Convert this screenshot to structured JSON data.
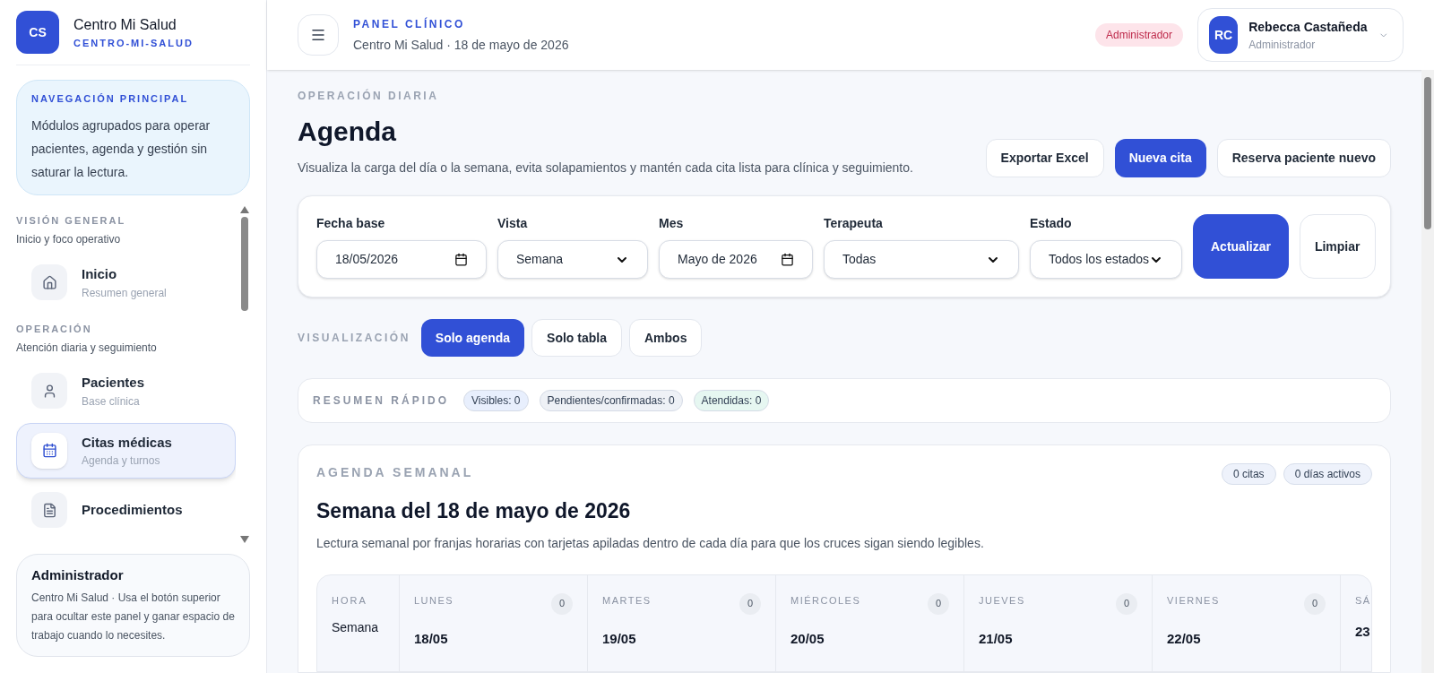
{
  "brand": {
    "initials": "CS",
    "name": "Centro Mi Salud",
    "slug": "CENTRO-MI-SALUD"
  },
  "sidebar": {
    "intro": {
      "title": "NAVEGACIÓN PRINCIPAL",
      "text": "Módulos agrupados para operar pacientes, agenda y gestión sin saturar la lectura."
    },
    "sections": [
      {
        "title": "VISIÓN GENERAL",
        "subtitle": "Inicio y foco operativo",
        "items": [
          {
            "kind": "home",
            "label": "Inicio",
            "sub": "Resumen general",
            "selected": false
          }
        ]
      },
      {
        "title": "OPERACIÓN",
        "subtitle": "Atención diaria y seguimiento",
        "items": [
          {
            "kind": "person",
            "label": "Pacientes",
            "sub": "Base clínica",
            "selected": false
          },
          {
            "kind": "calendar",
            "label": "Citas médicas",
            "sub": "Agenda y turnos",
            "selected": true
          },
          {
            "kind": "document",
            "label": "Procedimientos",
            "selected": false
          }
        ]
      }
    ],
    "footer": {
      "title": "Administrador",
      "text": "Centro Mi Salud · Usa el botón superior para ocultar este panel y ganar espacio de trabajo cuando lo necesites."
    }
  },
  "header": {
    "eyebrow": "PANEL CLÍNICO",
    "subtitle": "Centro Mi Salud · 18 de mayo de 2026",
    "role_badge": "Administrador",
    "user": {
      "initials": "RC",
      "name": "Rebecca Castañeda",
      "role": "Administrador"
    }
  },
  "page": {
    "eyebrow": "OPERACIÓN DIARIA",
    "title": "Agenda",
    "description": "Visualiza la carga del día o la semana, evita solapamientos y mantén cada cita lista para clínica y seguimiento.",
    "actions": [
      {
        "label": "Exportar Excel",
        "primary": false
      },
      {
        "label": "Nueva cita",
        "primary": true
      },
      {
        "label": "Reserva paciente nuevo",
        "primary": false
      }
    ]
  },
  "filters": {
    "fields": [
      {
        "kind": "date",
        "label": "Fecha base",
        "value": "18/05/2026"
      },
      {
        "kind": "select",
        "label": "Vista",
        "value": "Semana"
      },
      {
        "kind": "date",
        "label": "Mes",
        "value": "Mayo de 2026"
      },
      {
        "kind": "select",
        "label": "Terapeuta",
        "value": "Todas"
      },
      {
        "kind": "select",
        "label": "Estado",
        "value": "Todos los estados"
      }
    ],
    "buttons": [
      {
        "label": "Actualizar",
        "primary": true
      },
      {
        "label": "Limpiar",
        "primary": false
      }
    ]
  },
  "view_toggle": {
    "label": "VISUALIZACIÓN",
    "options": [
      {
        "label": "Solo agenda",
        "selected": true
      },
      {
        "label": "Solo tabla",
        "selected": false
      },
      {
        "label": "Ambos",
        "selected": false
      }
    ]
  },
  "summary": {
    "label": "RESUMEN RÁPIDO",
    "chips": [
      {
        "label": "Visibles: 0",
        "color": "#e8effd"
      },
      {
        "label": "Pendientes/confirmadas: 0",
        "color": "#eef1f6"
      },
      {
        "label": "Atendidas: 0",
        "color": "#e6f7f1"
      }
    ]
  },
  "week": {
    "eyebrow": "AGENDA SEMANAL",
    "title": "Semana del 18 de mayo de 2026",
    "description": "Lectura semanal por franjas horarias con tarjetas apiladas dentro de cada día para que los cruces sigan siendo legibles.",
    "badges": [
      "0 citas",
      "0 días activos"
    ],
    "hour_column": {
      "label": "HORA",
      "value": "Semana"
    },
    "days": [
      {
        "name": "LUNES",
        "date": "18/05",
        "count": "0"
      },
      {
        "name": "MARTES",
        "date": "19/05",
        "count": "0"
      },
      {
        "name": "MIÉRCOLES",
        "date": "20/05",
        "count": "0"
      },
      {
        "name": "JUEVES",
        "date": "21/05",
        "count": "0"
      },
      {
        "name": "VIERNES",
        "date": "22/05",
        "count": "0"
      },
      {
        "name": "SÁ",
        "date": "23"
      }
    ]
  }
}
